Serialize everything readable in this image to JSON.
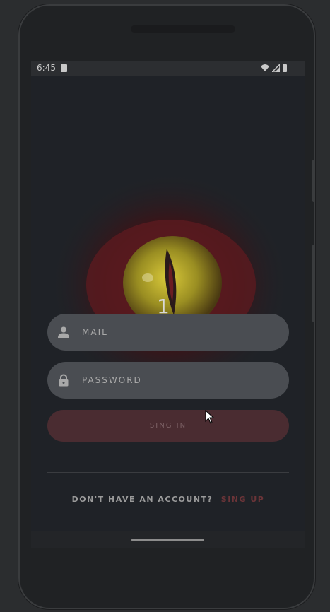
{
  "status_bar": {
    "time": "6:45"
  },
  "hero": {
    "number": "1"
  },
  "form": {
    "mail_placeholder": "MAIL",
    "password_placeholder": "PASSWORD",
    "signin_label": "SING IN"
  },
  "footer": {
    "prompt": "DON'T HAVE AN ACCOUNT?",
    "signup_label": "SING UP"
  },
  "colors": {
    "screen_bg": "#1f2227",
    "field_bg": "#4a4d52",
    "button_bg": "#4a2c31",
    "accent": "#6b3438"
  }
}
